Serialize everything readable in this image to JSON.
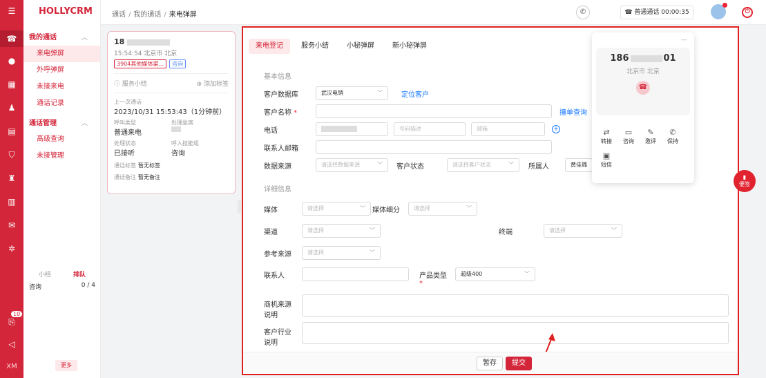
{
  "app": {
    "brand": "HOLLYCRM"
  },
  "rail": {
    "badge": "10",
    "xm": "XM"
  },
  "sidebar": {
    "group1": "我的通话",
    "items1": [
      "来电弹屏",
      "外呼弹屏",
      "未接来电",
      "通话记录"
    ],
    "group2": "通话管理",
    "items2": [
      "高级查询",
      "未接管理"
    ],
    "queue_tab1": "小结",
    "queue_tab2": "排队",
    "queue_label": "咨询",
    "queue_count": "0 / 4",
    "more": "更多"
  },
  "header": {
    "crumbs": [
      "通话",
      "我的通话",
      "来电弹屏"
    ],
    "call_status": "普通通话 00:00:35"
  },
  "card": {
    "number_prefix": "18",
    "time_loc": "15:54:54 北京市 北京",
    "tag1": "3904其他媒体渠...",
    "tag2": "咨询",
    "summary": "服务小结",
    "add_tag": "添加标签",
    "last_call_label": "上一次通话",
    "last_call": "2023/10/31 15:53:43（1分钟前）",
    "call_type_label": "呼叫类型",
    "call_type": "普通来电",
    "agent_label": "处理坐席",
    "status_label": "处理状态",
    "status": "已接听",
    "skill_label": "呼入技能组",
    "skill": "咨询",
    "tag_label": "通话标签",
    "tag_value": "暂无标签",
    "remark_label": "通话备注",
    "remark_value": "暂无备注"
  },
  "tabs": [
    "来电登记",
    "服务小结",
    "小秘弹屏",
    "新小秘弹屏"
  ],
  "form": {
    "section_basic": "基本信息",
    "db_label": "客户数据库",
    "db_value": "武汉电销",
    "locate": "定位客户",
    "name_label": "客户名称",
    "dup_check": "撞单查询",
    "phone_label": "电话",
    "phone_desc_ph": "号码描述",
    "email_small_ph": "邮箱",
    "contact_email_label": "联系人邮箱",
    "source_label": "数据来源",
    "source_ph": "请选择数据来源",
    "cust_status_label": "客户状态",
    "cust_status_ph": "请选择客户状态",
    "owner_label": "所属人",
    "owner_value": "黄佳璐",
    "section_detail": "详细信息",
    "media_label": "媒体",
    "media_sub_label": "媒体细分",
    "channel_label": "渠道",
    "terminal_label": "终端",
    "ref_label": "参考来源",
    "contact_label": "联系人",
    "product_label": "产品类型",
    "product_value": "超级400",
    "opportunity_label": "商机来源说明",
    "industry_label": "客户行业说明",
    "select_ph": "请选择",
    "save": "暂存",
    "submit": "提交"
  },
  "dial": {
    "number_prefix": "186",
    "number_suffix": "01",
    "location": "北京市 北京",
    "actions": [
      "转接",
      "咨询",
      "邀评",
      "保持",
      "短信"
    ]
  },
  "notes": "便签"
}
